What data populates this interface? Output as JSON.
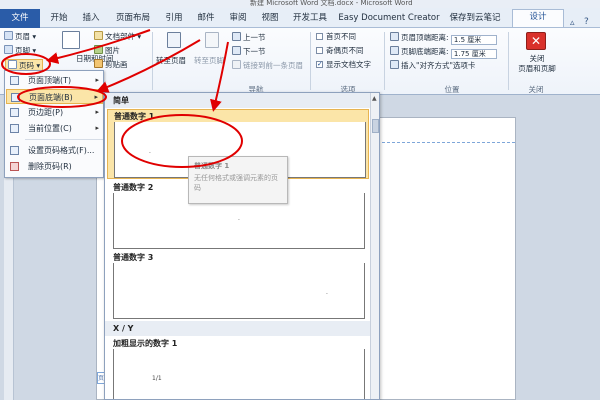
{
  "window": {
    "title": "新建 Microsoft Word 文档.docx - Microsoft Word"
  },
  "tabs": [
    {
      "label": "文件"
    },
    {
      "label": "开始"
    },
    {
      "label": "插入"
    },
    {
      "label": "页面布局"
    },
    {
      "label": "引用"
    },
    {
      "label": "邮件"
    },
    {
      "label": "审阅"
    },
    {
      "label": "视图"
    },
    {
      "label": "开发工具"
    },
    {
      "label": "Easy Document Creator"
    },
    {
      "label": "保存到云笔记"
    },
    {
      "label": "设计"
    }
  ],
  "ribbon": {
    "header": "页眉",
    "footer": "页脚",
    "page_number": "页码",
    "date_time": "日期和时间",
    "doc_parts": "文档部件",
    "picture": "图片",
    "clip_art": "剪贴画",
    "goto_header": "转至页眉",
    "goto_footer": "转至页脚",
    "prev_section": "上一节",
    "next_section": "下一节",
    "link_prev": "链接到前一条页眉",
    "nav_label": "导航",
    "first_page_diff": "首页不同",
    "odd_even_diff": "奇偶页不同",
    "show_doc_text": "显示文档文字",
    "options_label": "选项",
    "header_top_label": "页眉顶端距离:",
    "header_top_value": "1.5 厘米",
    "footer_bottom_label": "页脚底端距离:",
    "footer_bottom_value": "1.75 厘米",
    "insert_align_tab": "插入\"对齐方式\"选项卡",
    "position_label": "位置",
    "close_hf": "关闭\n页眉和页脚",
    "close_label": "关闭"
  },
  "menu": {
    "items": [
      {
        "label": "页面顶端(T)"
      },
      {
        "label": "页面底端(B)"
      },
      {
        "label": "页边距(P)"
      },
      {
        "label": "当前位置(C)"
      },
      {
        "label": "设置页码格式(F)..."
      },
      {
        "label": "删除页码(R)"
      }
    ]
  },
  "gallery": {
    "section_simple": "简单",
    "section_xy": "X / Y",
    "items": [
      {
        "label": "普通数字 1"
      },
      {
        "label": "普通数字 2"
      },
      {
        "label": "普通数字 3"
      },
      {
        "label": "加粗显示的数字 1",
        "thumb_text": "1/1"
      }
    ]
  },
  "tooltip": {
    "title": "普通数字 1",
    "desc": "无任何格式或强调元素的页码"
  },
  "page": {
    "tag": "页"
  },
  "colors": {
    "accent": "#2a5ca8",
    "highlight": "#fbe5a8",
    "annotation": "#e00000"
  }
}
